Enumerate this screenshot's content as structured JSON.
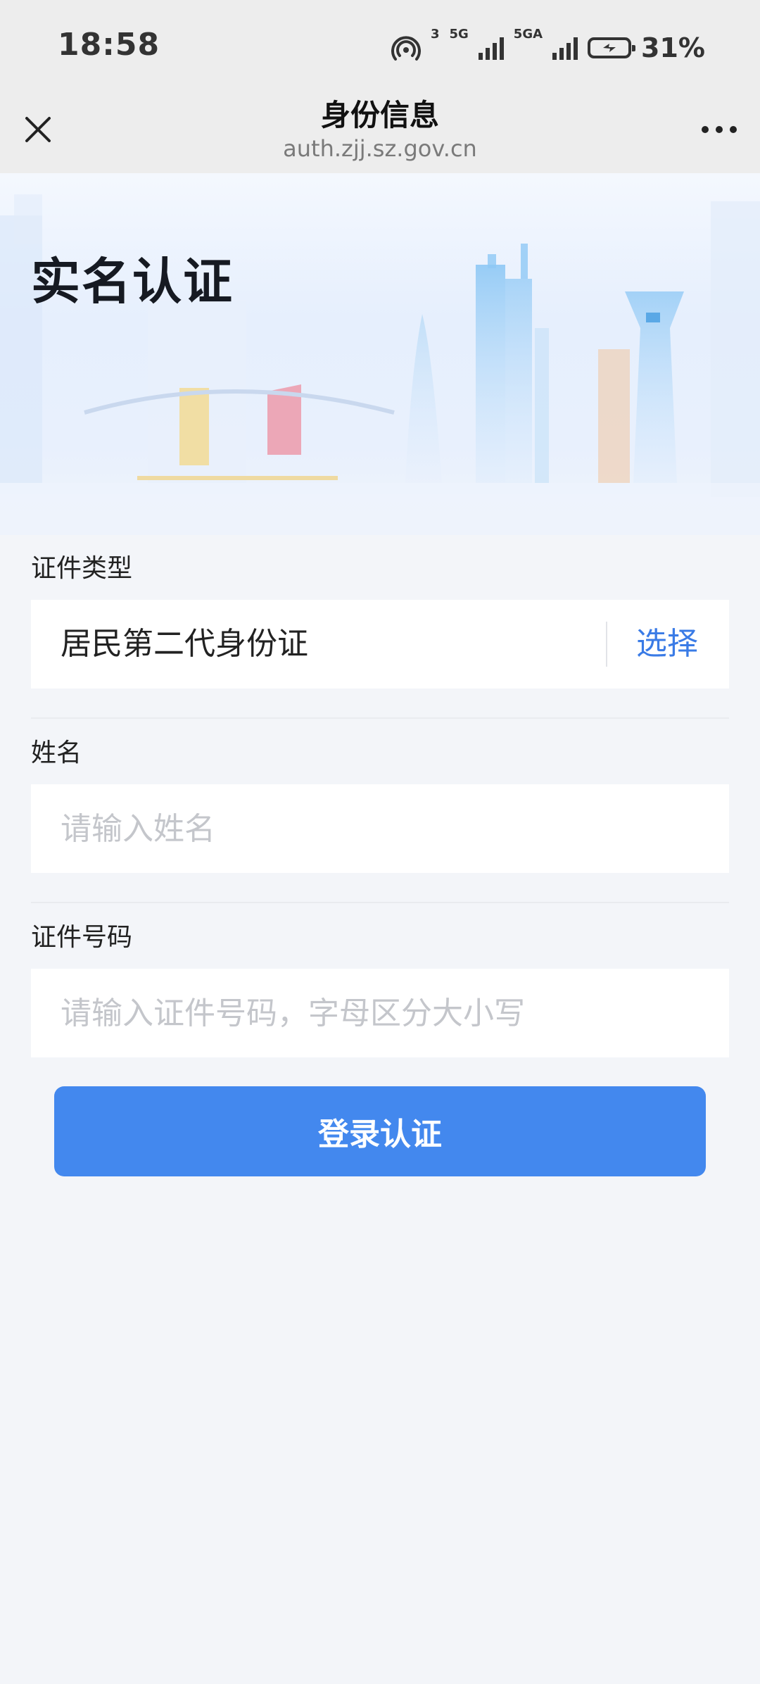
{
  "status_bar": {
    "time": "18:58",
    "network_1": "3",
    "network_2": "5G",
    "network_3": "5GA",
    "battery": "31%"
  },
  "nav": {
    "title": "身份信息",
    "subtitle": "auth.zjj.sz.gov.cn",
    "close_icon": "close-icon",
    "more_icon": "more-icon"
  },
  "hero": {
    "title": "实名认证"
  },
  "form": {
    "id_type": {
      "label": "证件类型",
      "value": "居民第二代身份证",
      "action": "选择"
    },
    "name": {
      "label": "姓名",
      "placeholder": "请输入姓名"
    },
    "id_number": {
      "label": "证件号码",
      "placeholder": "请输入证件号码，字母区分大小写"
    },
    "submit_label": "登录认证"
  },
  "colors": {
    "accent": "#4388ee",
    "link": "#3a7be6",
    "page_bg": "#f3f5f9",
    "bar_bg": "#ededed"
  }
}
